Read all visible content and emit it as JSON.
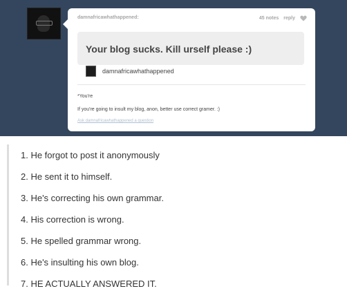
{
  "post": {
    "blog_name": "damnafricawhathappened:",
    "notes": "45 notes",
    "reply": "reply",
    "question": "Your blog sucks. Kill urself please :)",
    "asker": "damnafricawhathappened",
    "answer_line1": "*You're",
    "answer_line2": "If you're going to insult my blog, anon, better use correct gramer. :)",
    "ask_link": "Ask damnafricawhathappened a question"
  },
  "list": {
    "items": [
      "1. He forgot to post it anonymously",
      "2. He sent it to himself.",
      "3. He's correcting his own grammar.",
      "4. His correction is wrong.",
      "5. He spelled grammar wrong.",
      "6. He's insulting his own blog.",
      "7. HE ACTUALLY ANSWERED IT."
    ]
  },
  "icons": {
    "heart": "heart-icon"
  },
  "colors": {
    "dashboard": "#34465d",
    "card": "#ffffff",
    "ask_bubble": "#eeeeee",
    "link": "#aebfd0"
  }
}
